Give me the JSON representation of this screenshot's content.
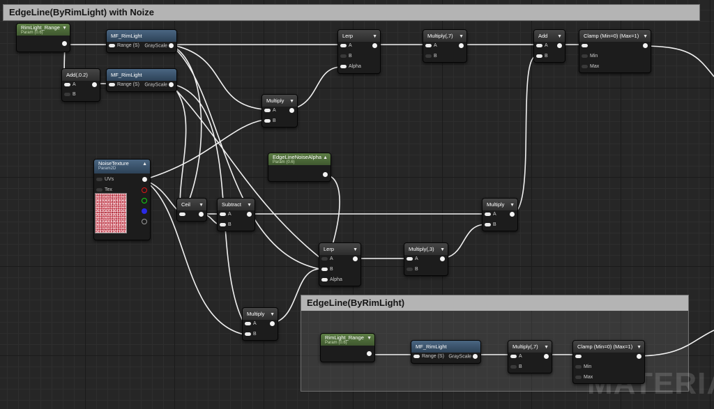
{
  "comments": {
    "noize": "EdgeLine(ByRimLight) with Noize",
    "rim": "EdgeLine(ByRimLight)"
  },
  "nodes": {
    "rimlight_range": {
      "title": "RimLight_Range",
      "sub": "Param (0.6)"
    },
    "mf_rimlight_1": {
      "title": "MF_RimLight",
      "in": "Range (S)",
      "out": "GrayScale"
    },
    "add_02": {
      "title": "Add(,0.2)",
      "a": "A",
      "b": "B"
    },
    "mf_rimlight_2": {
      "title": "MF_RimLight",
      "in": "Range (S)",
      "out": "GrayScale"
    },
    "lerp_1": {
      "title": "Lerp",
      "a": "A",
      "b": "B",
      "alpha": "Alpha"
    },
    "multiply_7": {
      "title": "Multiply(,7)",
      "a": "A",
      "b": "B"
    },
    "add": {
      "title": "Add",
      "a": "A",
      "b": "B"
    },
    "clamp": {
      "title": "Clamp (Min=0) (Max=1)",
      "min": "Min",
      "max": "Max"
    },
    "multiply_1": {
      "title": "Multiply",
      "a": "A",
      "b": "B"
    },
    "noise_alpha": {
      "title": "EdgeLineNoiseAlpha",
      "sub": "Param (0.6)"
    },
    "noise_texture": {
      "title": "NoiseTexture",
      "sub": "Param2D",
      "uvs": "UVs",
      "tex": "Tex"
    },
    "ceil": {
      "title": "Ceil"
    },
    "subtract": {
      "title": "Subtract",
      "a": "A",
      "b": "B"
    },
    "multiply_2": {
      "title": "Multiply",
      "a": "A",
      "b": "B"
    },
    "lerp_2": {
      "title": "Lerp",
      "a": "A",
      "b": "B",
      "alpha": "Alpha"
    },
    "multiply_3": {
      "title": "Multiply(,3)",
      "a": "A",
      "b": "B"
    },
    "multiply_4": {
      "title": "Multiply",
      "a": "A",
      "b": "B"
    },
    "rimlight_range_b": {
      "title": "RimLight_Range",
      "sub": "Param (0.6)"
    },
    "mf_rimlight_b": {
      "title": "MF_RimLight",
      "in": "Range (S)",
      "out": "GrayScale"
    },
    "multiply_7b": {
      "title": "Multiply(,7)",
      "a": "A",
      "b": "B"
    },
    "clamp_b": {
      "title": "Clamp (Min=0) (Max=1)",
      "min": "Min",
      "max": "Max"
    }
  },
  "watermark": "MATERIAL",
  "colors": {
    "graph_bg": "#262626",
    "comment_header": "#b4b4b4",
    "param_header": "#5d7e45",
    "function_header": "#4a6682",
    "math_header": "#464646",
    "wire": "#ffffff",
    "pin_red": "#e01414",
    "pin_green": "#14d214",
    "pin_blue": "#2a2ae6",
    "pin_alpha": "#9a9a9a"
  },
  "icons": {
    "node_collapse": "chevron-down-icon",
    "output_pin": "circle-pin-icon"
  }
}
